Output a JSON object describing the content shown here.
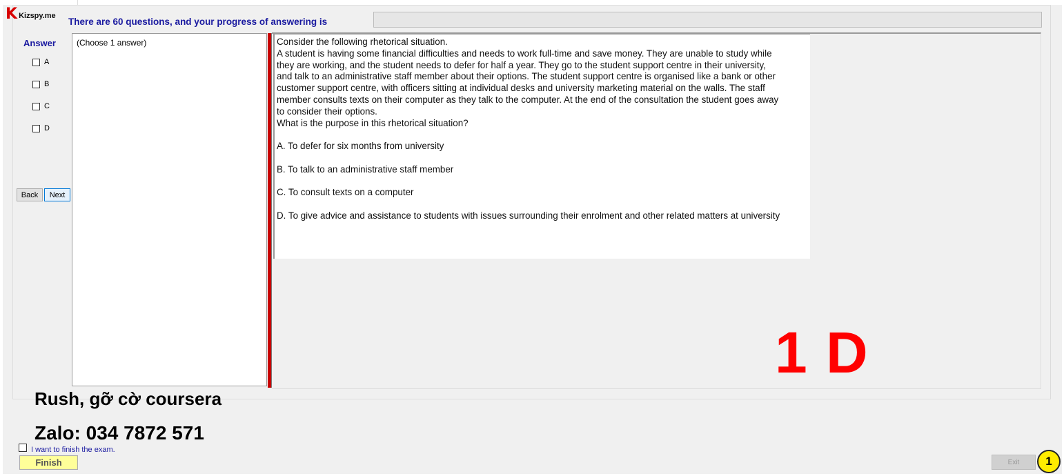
{
  "app": {
    "logo_text": "Kizspy.me"
  },
  "header": {
    "progress_label": "There are 60 questions, and your progress of answering is",
    "progress_percent": 0
  },
  "answer_panel": {
    "title": "Answer",
    "options": [
      "A",
      "B",
      "C",
      "D"
    ],
    "back_label": "Back",
    "next_label": "Next"
  },
  "choose_panel": {
    "instruction": "(Choose 1 answer)"
  },
  "question": {
    "lines": [
      "Consider the following rhetorical situation.",
      "A student is having some financial difficulties and needs to work full-time and save money. They are unable to study while they are working, and the student needs to defer for half a year. They go to the student support centre in their university, and talk to an administrative staff member about their options. The student support centre is organised like a bank or other customer support centre, with officers sitting at individual desks and university marketing material on the walls. The staff member consults texts on their computer as they talk to the computer. At the end of the consultation the student goes away to consider their options.",
      "What is the purpose in this rhetorical situation?"
    ],
    "choices": [
      "A.  To defer for six months from university",
      "B.  To talk to an administrative staff member",
      "C.  To consult texts on a computer",
      "D.  To give advice and assistance to students with issues surrounding their enrolment and other related matters at university"
    ]
  },
  "overlay": {
    "answer_marker": "1 D",
    "note_line1": "Rush, gỡ cờ coursera",
    "note_line2": "Zalo: 034 7872 571"
  },
  "footer": {
    "finish_checkbox_label": "I want to finish the exam.",
    "finish_label": "Finish",
    "exit_label": "Exit",
    "badge_number": "1"
  }
}
